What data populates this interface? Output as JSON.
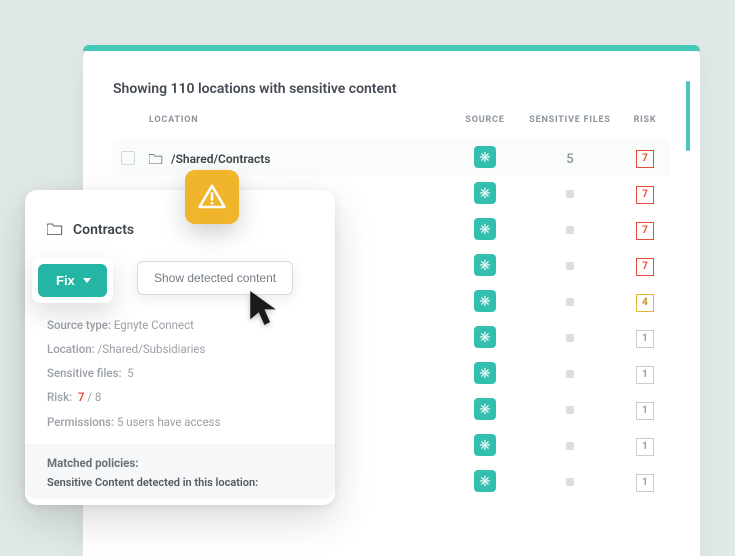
{
  "header": {
    "title": "Showing 110 locations with sensitive content"
  },
  "columns": {
    "location": "LOCATION",
    "source": "SOURCE",
    "sensitive": "SENSITIVE FILES",
    "risk": "RISK"
  },
  "rows": [
    {
      "path": "/Shared/Contracts",
      "sensitive": "5",
      "risk": "7",
      "risk_level": "red",
      "real": true
    },
    {
      "risk": "7",
      "risk_level": "red"
    },
    {
      "risk": "7",
      "risk_level": "red"
    },
    {
      "risk": "7",
      "risk_level": "red"
    },
    {
      "risk": "4",
      "risk_level": "amber"
    },
    {
      "risk": "1",
      "risk_level": "gray"
    },
    {
      "risk": "1",
      "risk_level": "gray"
    },
    {
      "risk": "1",
      "risk_level": "gray"
    },
    {
      "risk": "1",
      "risk_level": "gray"
    },
    {
      "risk": "1",
      "risk_level": "gray"
    }
  ],
  "popover": {
    "folder_name": "Contracts",
    "fix_label": "Fix",
    "show_label": "Show detected content",
    "source_type_label": "Source type:",
    "source_type_value": "Egnyte Connect",
    "location_label": "Location:",
    "location_value": "/Shared/Subsidiaries",
    "sensitive_label": "Sensitive files:",
    "sensitive_value": "5",
    "risk_label": "Risk:",
    "risk_value": "7",
    "risk_max": "/ 8",
    "perms_label": "Permissions:",
    "perms_value": "5 users have access",
    "matched_header": "Matched policies:",
    "matched_sub": "Sensitive Content detected in this location:"
  }
}
